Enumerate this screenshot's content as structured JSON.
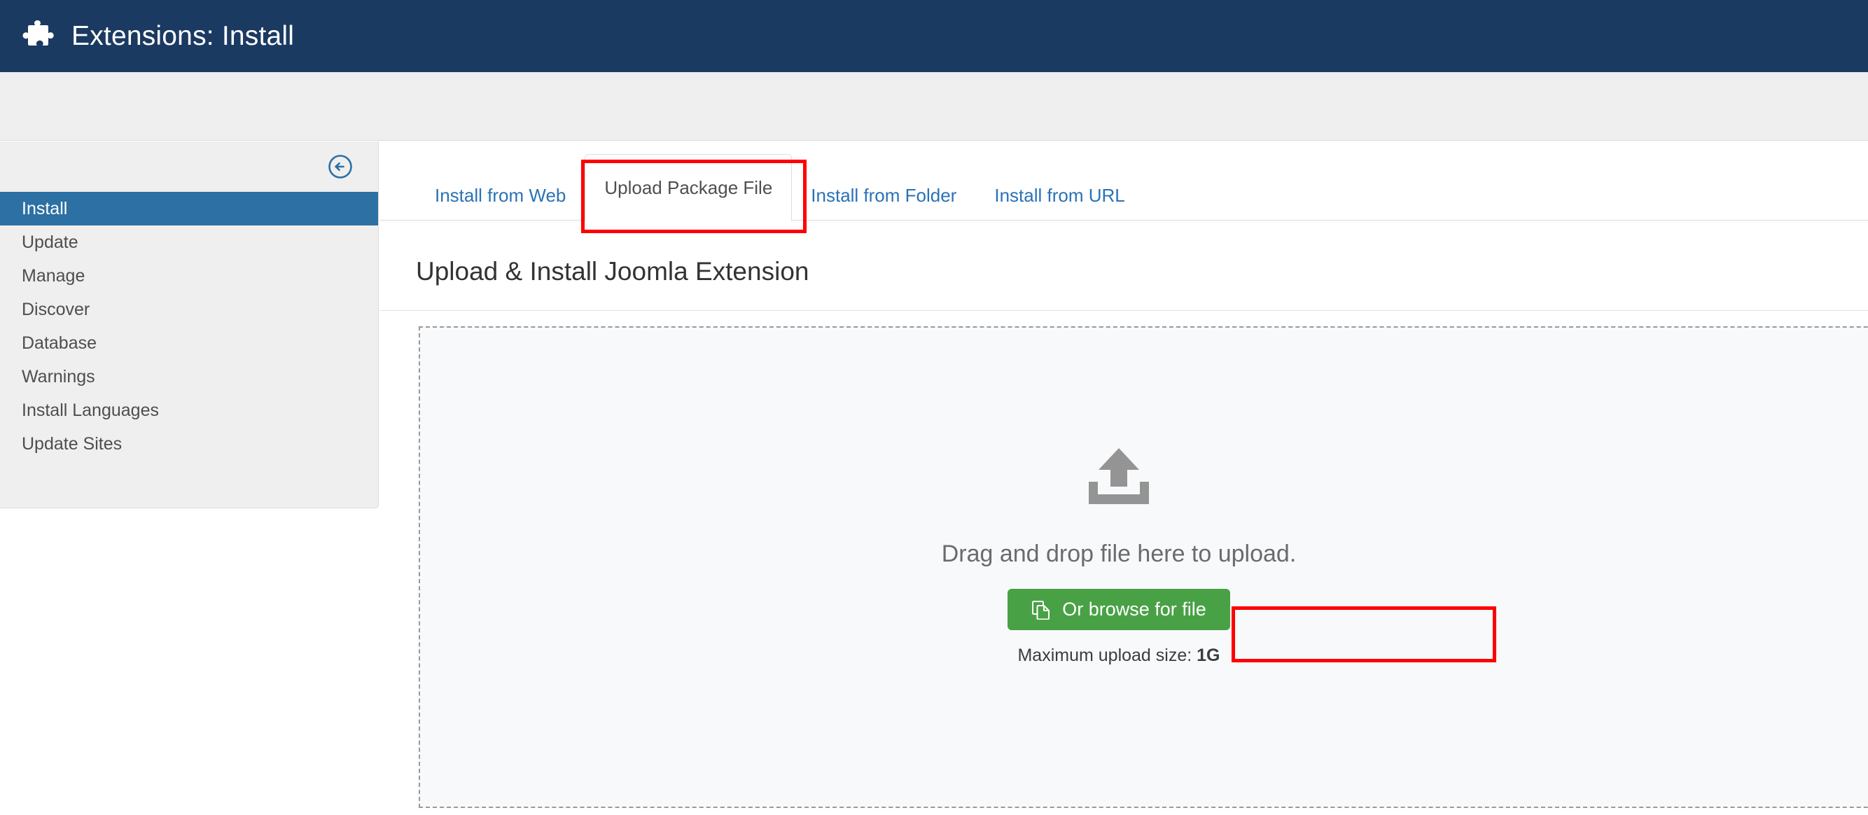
{
  "header": {
    "title": "Extensions: Install",
    "icon": "puzzle-piece-icon",
    "background_color": "#1b3a62"
  },
  "sidebar": {
    "collapse_icon": "circle-arrow-left-icon",
    "items": [
      {
        "label": "Install",
        "active": true
      },
      {
        "label": "Update",
        "active": false
      },
      {
        "label": "Manage",
        "active": false
      },
      {
        "label": "Discover",
        "active": false
      },
      {
        "label": "Database",
        "active": false
      },
      {
        "label": "Warnings",
        "active": false
      },
      {
        "label": "Install Languages",
        "active": false
      },
      {
        "label": "Update Sites",
        "active": false
      }
    ],
    "active_color": "#2c70a4"
  },
  "main": {
    "tabs": [
      {
        "label": "Install from Web",
        "active": false
      },
      {
        "label": "Upload Package File",
        "active": true
      },
      {
        "label": "Install from Folder",
        "active": false
      },
      {
        "label": "Install from URL",
        "active": false
      }
    ],
    "heading": "Upload & Install Joomla Extension",
    "dropzone": {
      "icon": "upload-tray-icon",
      "message": "Drag and drop file here to upload.",
      "browse_button": {
        "label": "Or browse for file",
        "icon": "copy-files-icon",
        "color": "#49a146"
      },
      "max_size_label": "Maximum upload size:",
      "max_size_value": "1G"
    }
  },
  "annotations": {
    "color": "#fe0000",
    "boxes": [
      {
        "target": "Upload Package File"
      },
      {
        "target": "Or browse for file"
      }
    ]
  }
}
